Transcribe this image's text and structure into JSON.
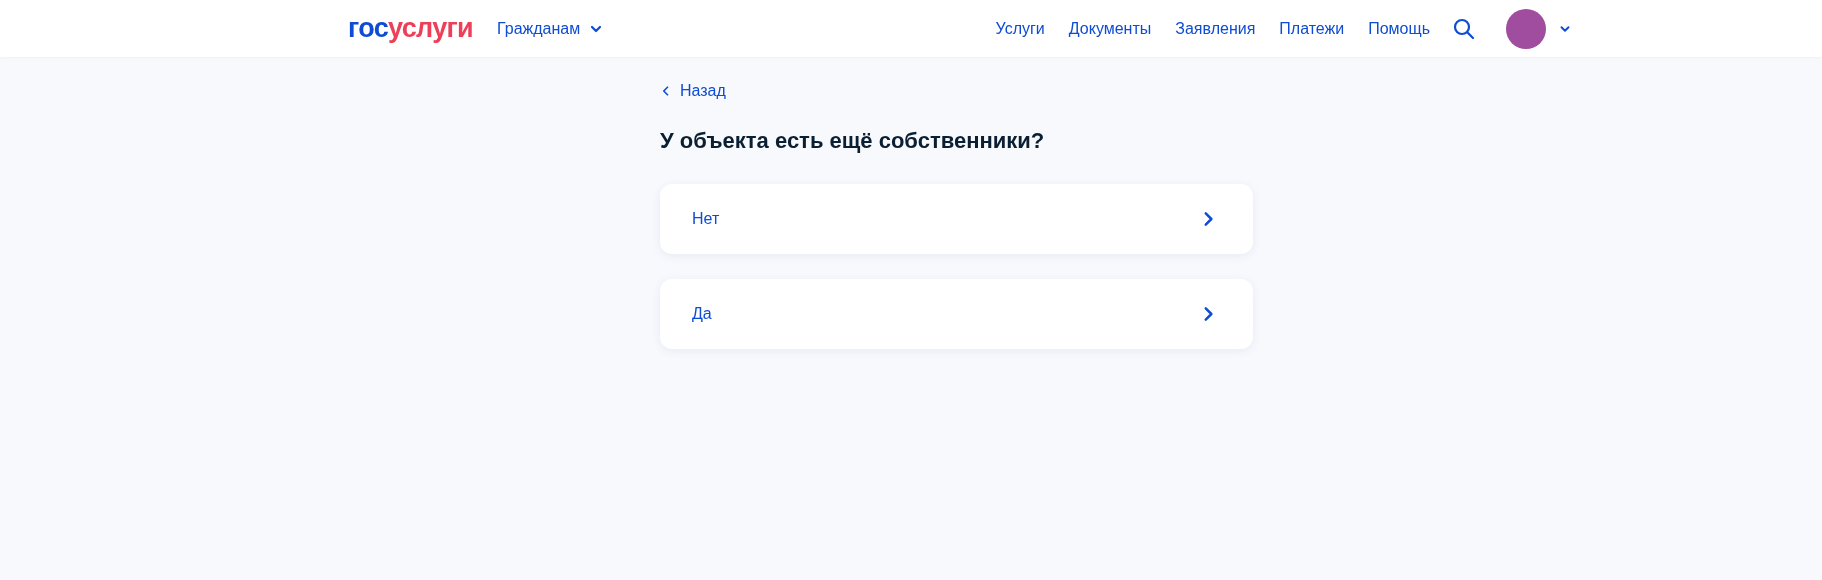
{
  "header": {
    "logo": {
      "part1": "гос",
      "part2": "услуги"
    },
    "audience_menu": "Гражданам",
    "nav": [
      "Услуги",
      "Документы",
      "Заявления",
      "Платежи",
      "Помощь"
    ],
    "avatar": {
      "color": "#a04c9f"
    }
  },
  "back_link": "Назад",
  "title": "У объекта есть ещё собственники?",
  "options": [
    {
      "label": "Нет"
    },
    {
      "label": "Да"
    }
  ]
}
